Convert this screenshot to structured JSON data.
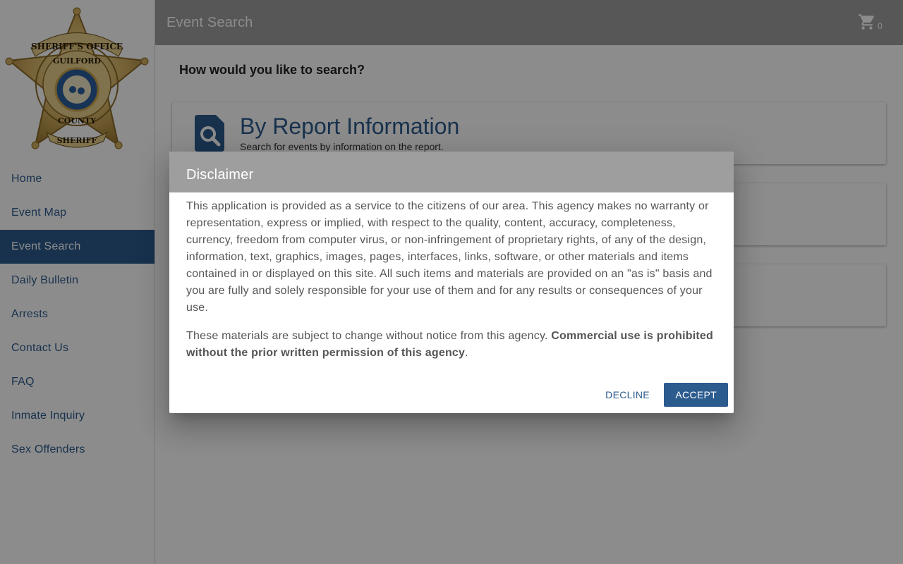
{
  "sidebar": {
    "logo_text": [
      "SHERIFF'S OFFICE",
      "GUILFORD",
      "COUNTY",
      "SHERIFF"
    ],
    "items": [
      {
        "label": "Home"
      },
      {
        "label": "Event Map"
      },
      {
        "label": "Event Search"
      },
      {
        "label": "Daily Bulletin"
      },
      {
        "label": "Arrests"
      },
      {
        "label": "Contact Us"
      },
      {
        "label": "FAQ"
      },
      {
        "label": "Inmate Inquiry"
      },
      {
        "label": "Sex Offenders"
      }
    ],
    "active_index": 2
  },
  "header": {
    "title": "Event Search",
    "cart_icon": "shopping-cart-icon",
    "cart_count": "0"
  },
  "main": {
    "heading": "How would you like to search?",
    "cards": [
      {
        "title": "By Report Information",
        "subtitle": "Search for events by information on the report.",
        "icon": "document-search-icon"
      }
    ]
  },
  "dialog": {
    "title": "Disclaimer",
    "paragraph1": "This application is provided as a service to the citizens of our area. This agency makes no warranty or representation, express or implied, with respect to the quality, content, accuracy, completeness, currency, freedom from computer virus, or non-infringement of proprietary rights, of any of the design, information, text, graphics, images, pages, interfaces, links, software, or other materials and items contained in or displayed on this site. All such items and materials are provided on an \"as is\" basis and you are fully and solely responsible for your use of them and for any results or consequences of your use.",
    "paragraph2_text": "These materials are subject to change without notice from this agency. ",
    "paragraph2_bold": "Commercial use is prohibited without the prior written permission of this agency",
    "paragraph2_end": ".",
    "decline_label": "Decline",
    "accept_label": "Accept"
  },
  "colors": {
    "accent": "#2c5b8e",
    "header_bg": "#9e9e9e",
    "badge_gold": "#d4b062"
  }
}
